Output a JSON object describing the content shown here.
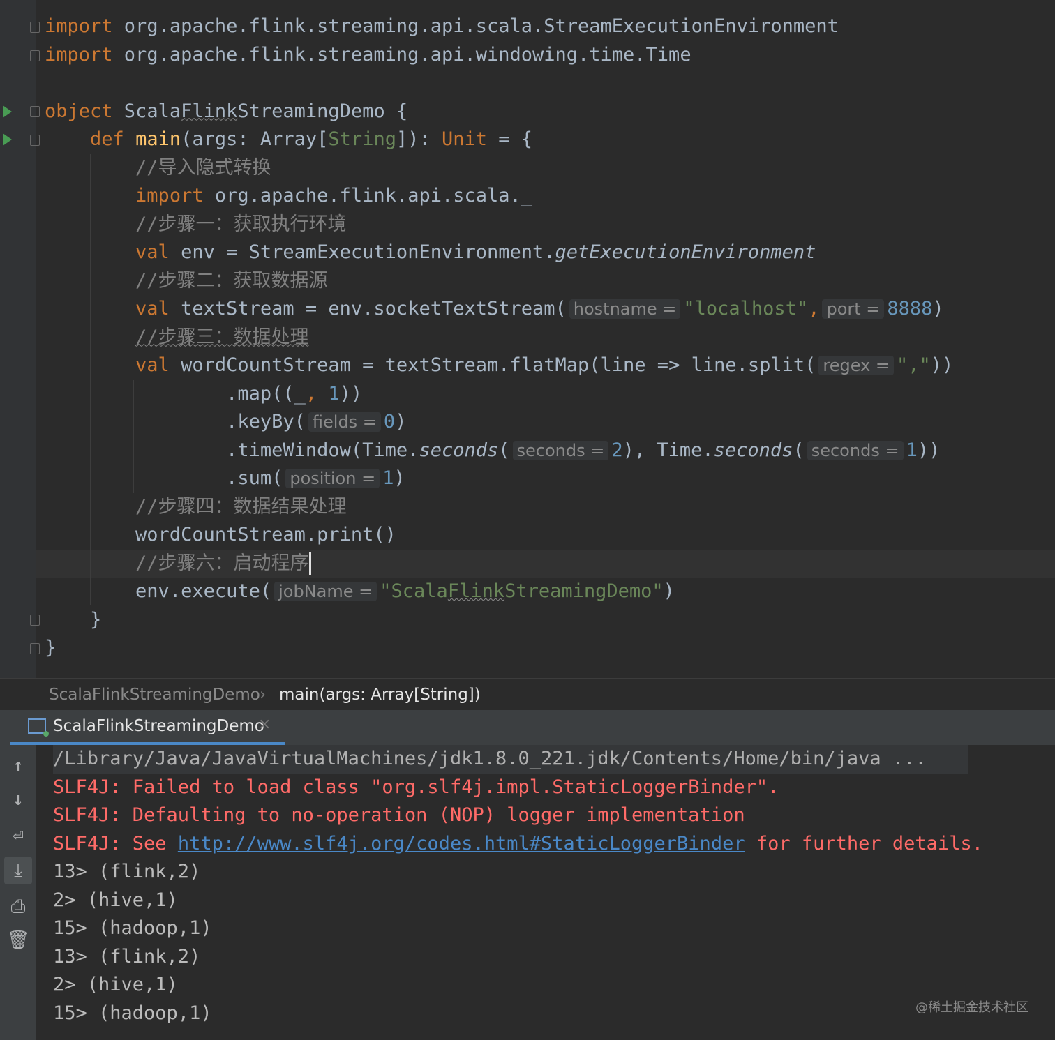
{
  "editor": {
    "lines": [
      {
        "kw": "import",
        "rest": " org.apache.flink.streaming.api.scala.StreamExecutionEnvironment"
      },
      {
        "kw": "import",
        "rest": " org.apache.flink.streaming.api.windowing.time.Time"
      },
      {},
      {
        "kw": "object",
        "name_a": " Scala",
        "name_b": "Flink",
        "name_c": "StreamingDemo",
        "rest": " {"
      },
      {
        "indent": "    ",
        "kw": "def",
        "fn": " main",
        "rest_a": "(args: Array[",
        "type": "String",
        "rest_b": "]): ",
        "kw2": "Unit",
        "rest_c": " = {"
      },
      {
        "indent": "        ",
        "comment": "//导入隐式转换"
      },
      {
        "indent": "        ",
        "kw": "import",
        "rest": " org.apache.flink.api.scala._"
      },
      {
        "indent": "        ",
        "comment": "//步骤一：获取执行环境"
      },
      {
        "indent": "        ",
        "kw": "val",
        "rest": " env = StreamExecutionEnvironment.",
        "it": "getExecutionEnvironment"
      },
      {
        "indent": "        ",
        "comment": "//步骤二：获取数据源"
      },
      {
        "indent": "        ",
        "kw": "val",
        "rest": " textStream = env.socketTextStream(",
        "hint1": "hostname =",
        "str": "\"localhost\"",
        "comma": ",",
        "hint2": "port =",
        "num": "8888",
        "end": ")"
      },
      {
        "indent": "        ",
        "comment": "//步骤三：数据处理"
      },
      {
        "indent": "        ",
        "kw": "val",
        "rest": " wordCountStream = textStream.flatMap(line => line.split(",
        "hint": "regex =",
        "str": "\",\"",
        "end": "))"
      },
      {
        "indent": "                ",
        "rest": ".map((_",
        "comma": ", ",
        "num": "1",
        "end": "))"
      },
      {
        "indent": "                ",
        "rest": ".keyBy(",
        "hint": "fields =",
        "num": "0",
        "end": ")"
      },
      {
        "indent": "                ",
        "rest": ".timeWindow(Time.",
        "it1": "seconds",
        "p1": "(",
        "hint1": "seconds =",
        "num1": "2",
        "mid": "), Time.",
        "it2": "seconds",
        "p2": "(",
        "hint2": "seconds =",
        "num2": "1",
        "end": "))"
      },
      {
        "indent": "                ",
        "rest": ".sum(",
        "hint": "position =",
        "num": "1",
        "end": ")"
      },
      {
        "indent": "        ",
        "comment": "//步骤四：数据结果处理"
      },
      {
        "indent": "        ",
        "rest": "wordCountStream.print()"
      },
      {
        "indent": "        ",
        "comment": "//步骤六：启动程序"
      },
      {
        "indent": "        ",
        "rest": "env.execute(",
        "hint": "jobName =",
        "str_a": "\"Scala",
        "str_b": "Flink",
        "str_c": "StreamingDemo\"",
        "end": ")"
      },
      {
        "indent": "    ",
        "rest": "}"
      },
      {
        "rest": "}"
      }
    ]
  },
  "breadcrumb": {
    "item1": "ScalaFlinkStreamingDemo",
    "separator": "›",
    "item2": "main(args: Array[String])"
  },
  "run_tab": {
    "label": "ScalaFlinkStreamingDemo",
    "close": "×"
  },
  "console": {
    "command": "/Library/Java/JavaVirtualMachines/jdk1.8.0_221.jdk/Contents/Home/bin/java ...",
    "err1": "SLF4J: Failed to load class \"org.slf4j.impl.StaticLoggerBinder\".",
    "err2": "SLF4J: Defaulting to no-operation (NOP) logger implementation",
    "err3_a": "SLF4J: See ",
    "err3_link": "http://www.slf4j.org/codes.html#StaticLoggerBinder",
    "err3_b": " for further details.",
    "output": [
      "13> (flink,2)",
      "2> (hive,1)",
      "15> (hadoop,1)",
      "13> (flink,2)",
      "2> (hive,1)",
      "15> (hadoop,1)"
    ]
  },
  "toolbar": {
    "up": "↑",
    "down": "↓",
    "wrap": "⏎",
    "scroll": "⤓",
    "print": "⎙",
    "trash": "🗑"
  },
  "watermark": "@稀土掘金技术社区"
}
